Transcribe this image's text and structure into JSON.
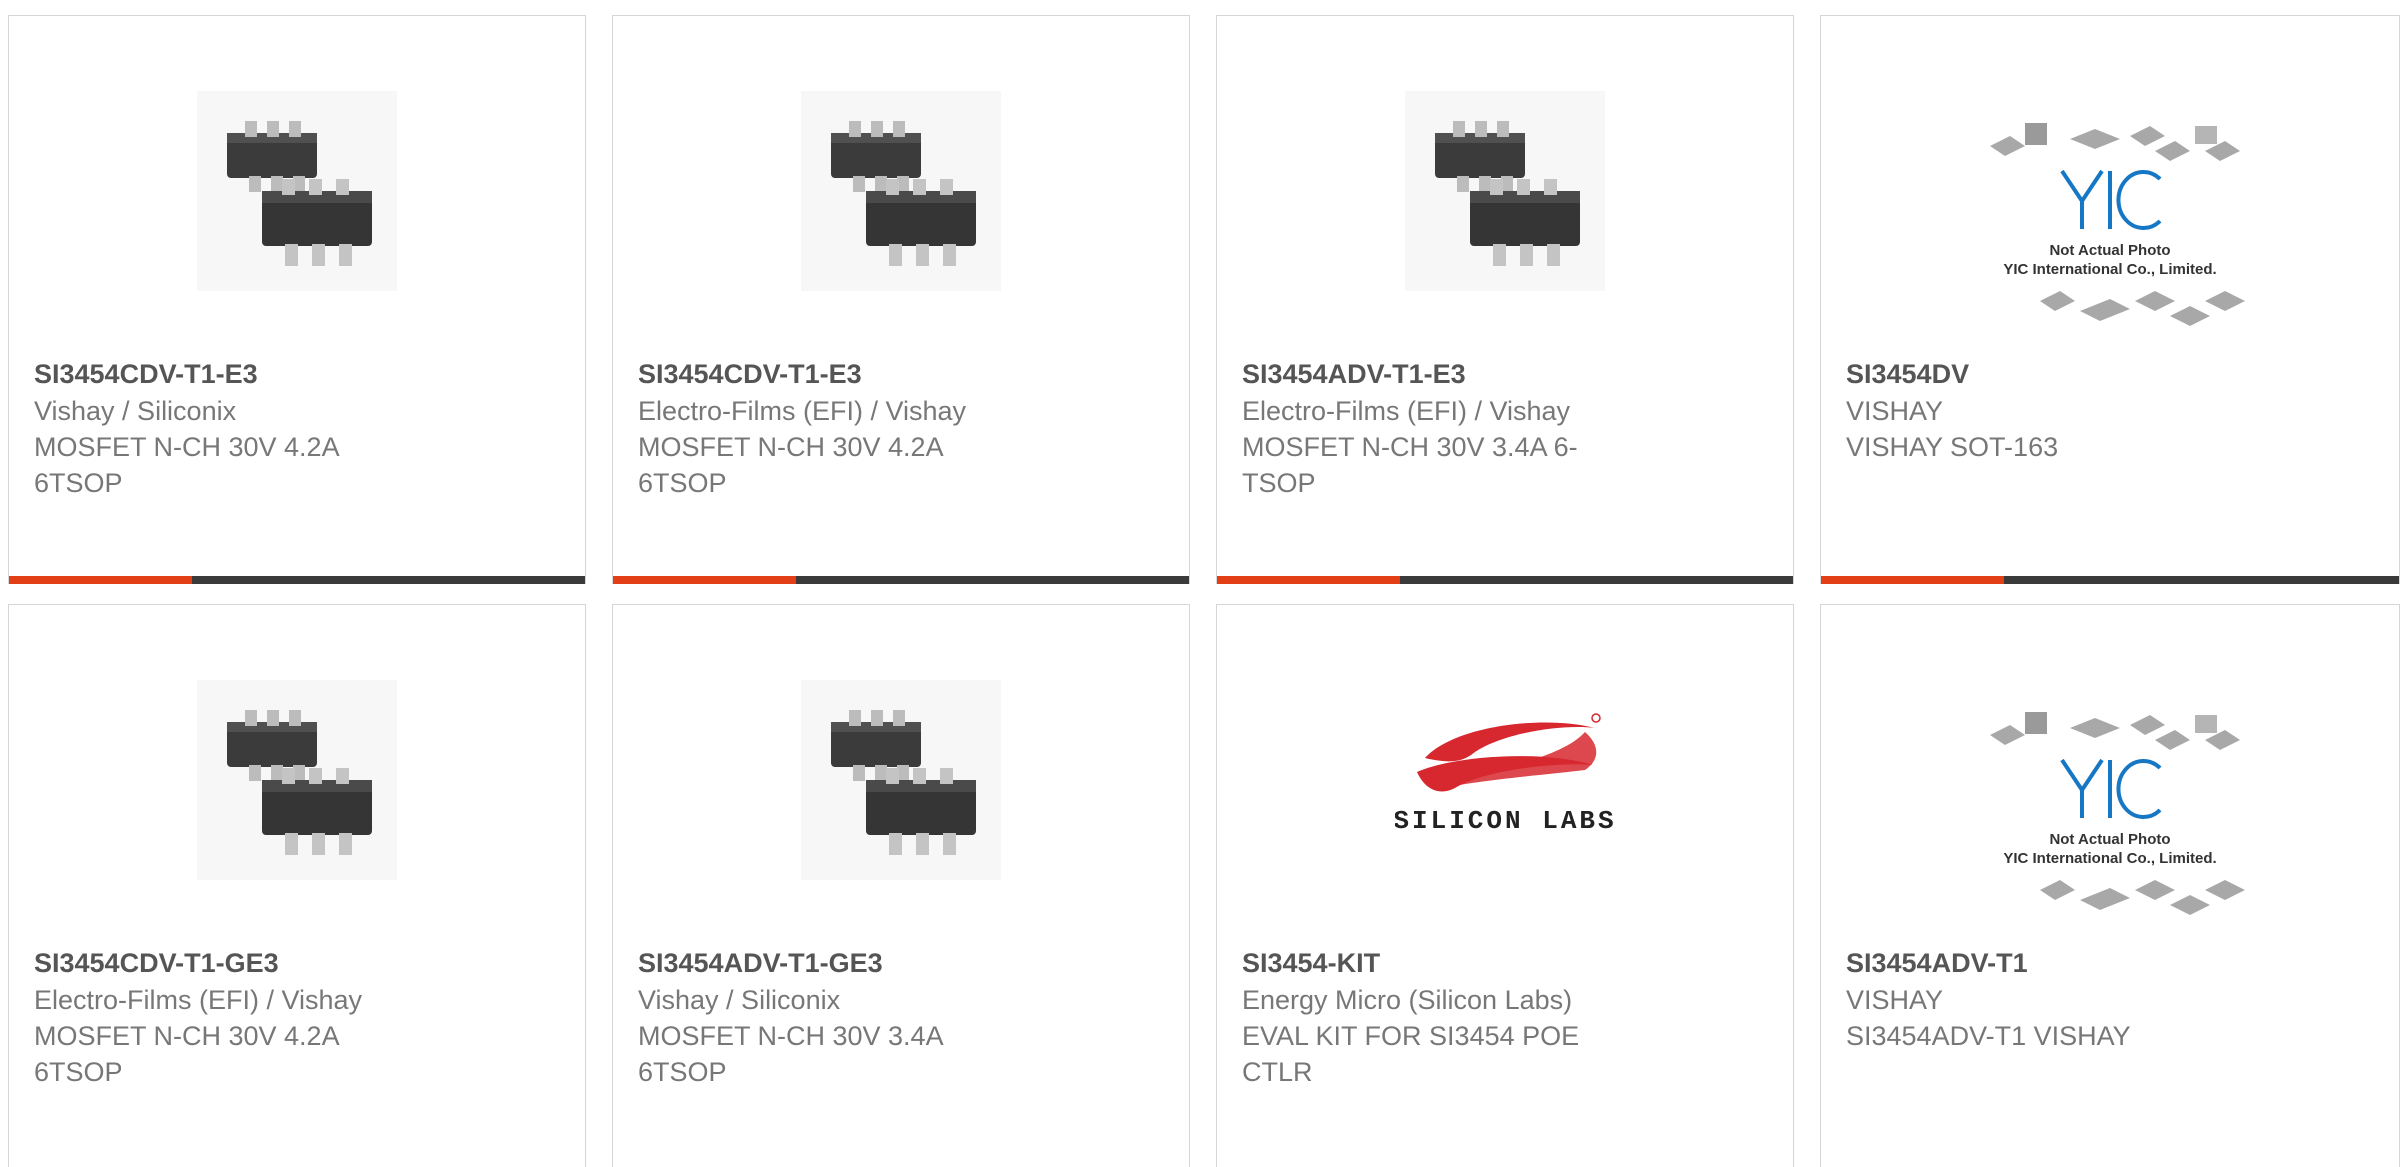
{
  "brand_colors": {
    "accent": "#e33f17",
    "bar": "#3a3a3a",
    "silicon_labs_red": "#d7282f"
  },
  "cards": [
    {
      "part_number": "SI3454CDV-T1-E3",
      "manufacturer": "Vishay / Siliconix",
      "description": "MOSFET N-CH 30V 4.2A 6TSOP",
      "image": "tsop6-chip-photo"
    },
    {
      "part_number": "SI3454CDV-T1-E3",
      "manufacturer": "Electro-Films (EFI) / Vishay",
      "description": "MOSFET N-CH 30V 4.2A 6TSOP",
      "image": "tsop6-chip-photo"
    },
    {
      "part_number": "SI3454ADV-T1-E3",
      "manufacturer": "Electro-Films (EFI) / Vishay",
      "description": "MOSFET N-CH 30V 3.4A 6-TSOP",
      "image": "tsop6-chip-photo"
    },
    {
      "part_number": "SI3454DV",
      "manufacturer": "VISHAY",
      "description": "VISHAY SOT-163",
      "image": "yic-placeholder",
      "image_caption_1": "Not Actual Photo",
      "image_caption_2": "YIC International Co., Limited."
    },
    {
      "part_number": "SI3454CDV-T1-GE3",
      "manufacturer": "Electro-Films (EFI) / Vishay",
      "description": "MOSFET N-CH 30V 4.2A 6TSOP",
      "image": "tsop6-chip-photo"
    },
    {
      "part_number": "SI3454ADV-T1-GE3",
      "manufacturer": "Vishay / Siliconix",
      "description": "MOSFET N-CH 30V 3.4A 6TSOP",
      "image": "tsop6-chip-photo"
    },
    {
      "part_number": "SI3454-KIT",
      "manufacturer": "Energy Micro (Silicon Labs)",
      "description": "EVAL KIT FOR SI3454 POE CTLR",
      "image": "silicon-labs-logo",
      "logo_text": "SILICON LABS"
    },
    {
      "part_number": "SI3454ADV-T1",
      "manufacturer": "VISHAY",
      "description": "SI3454ADV-T1 VISHAY",
      "image": "yic-placeholder",
      "image_caption_1": "Not Actual Photo",
      "image_caption_2": "YIC International Co., Limited."
    }
  ]
}
